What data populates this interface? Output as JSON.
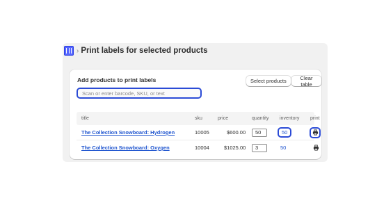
{
  "header": {
    "app_icon": "app-grid-icon",
    "breadcrumb_separator": "›",
    "title": "Print labels for selected products"
  },
  "card": {
    "title": "Add products to print labels",
    "select_button": "Select products",
    "clear_button": "Clear table",
    "search_placeholder": "Scan or enter barcode, SKU, or text"
  },
  "table": {
    "columns": {
      "title": "title",
      "sku": "sku",
      "price": "price",
      "quantity": "quantity",
      "inventory": "inventory",
      "print": "print"
    },
    "rows": [
      {
        "title": "The Collection Snowboard: Hydrogen",
        "sku": "10005",
        "price": "$600.00",
        "quantity": "50",
        "inventory": "50",
        "print_icon": "printer-icon"
      },
      {
        "title": "The Collection Snowboard: Oxygen",
        "sku": "10004",
        "price": "$1025.00",
        "quantity": "3",
        "inventory": "50",
        "print_icon": "printer-icon"
      }
    ]
  },
  "colors": {
    "accent": "#2b4bd6",
    "link": "#1f55cf",
    "panel_bg": "#f1f1f1"
  }
}
